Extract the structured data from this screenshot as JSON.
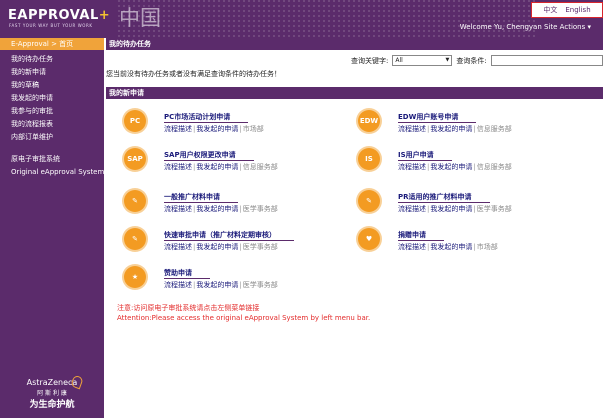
{
  "header": {
    "logo": "EAPPROVAL",
    "logo_plus": "+",
    "tagline": "FAST YOUR WAY BUT YOUR WORK",
    "brand_glyph": "中国",
    "lang_cn": "中文",
    "lang_en": "English",
    "welcome": "Welcome Yu, Chengyan",
    "site_actions": "Site Actions ▾"
  },
  "sidebar": {
    "home": "E-Approval > 首页",
    "items": [
      "我的待办任务",
      "我的新申请",
      "我的草稿",
      "我发起的申请",
      "我参与的审批",
      "我的流程报表",
      "内部订单维护"
    ],
    "legacy": [
      "原电子审批系统",
      "Original eApproval System"
    ],
    "footer_name": "AstraZeneca",
    "footer_cn1": "阿 斯 利 康",
    "footer_cn2": "为生命护航"
  },
  "tasks": {
    "title": "我的待办任务",
    "keyword_label": "查询关键字:",
    "keyword_value": "All",
    "condition_label": "查询条件:",
    "empty": "您当前没有待办任务或者没有满足查询条件的待办任务！"
  },
  "apps": {
    "title": "我的新申请",
    "items": [
      {
        "title": "PC市场活动计划申请",
        "link1": "流程描述",
        "link2": "我发起的申请",
        "dept": "市场部",
        "glyph": "PC"
      },
      {
        "title": "EDW用户账号申请",
        "link1": "流程描述",
        "link2": "我发起的申请",
        "dept": "信息服务部",
        "glyph": "EDW"
      },
      {
        "title": "SAP用户权限更改申请",
        "link1": "流程描述",
        "link2": "我发起的申请",
        "dept": "信息服务部",
        "glyph": "SAP"
      },
      {
        "title": "IS用户申请",
        "link1": "流程描述",
        "link2": "我发起的申请",
        "dept": "信息服务部",
        "glyph": "IS"
      },
      {
        "title": "一般推广材料申请",
        "link1": "流程描述",
        "link2": "我发起的申请",
        "dept": "医学事务部",
        "glyph": "✎"
      },
      {
        "title": "PR适用的推广材料申请",
        "link1": "流程描述",
        "link2": "我发起的申请",
        "dept": "医学事务部",
        "glyph": "✎"
      },
      {
        "title": "快速审批申请（推广材料定期审核）",
        "link1": "流程描述",
        "link2": "我发起的申请",
        "dept": "医学事务部",
        "glyph": "✎"
      },
      {
        "title": "捐赠申请",
        "link1": "流程描述",
        "link2": "我发起的申请",
        "dept": "市场部",
        "glyph": "♥"
      },
      {
        "title": "赞助申请",
        "link1": "流程描述",
        "link2": "我发起的申请",
        "dept": "医学事务部",
        "glyph": "★"
      }
    ]
  },
  "notice": {
    "cn": "注意:访问原电子审批系统请点击左侧菜单链接",
    "en": "Attention:Please access the original eApproval System by left menu bar."
  }
}
